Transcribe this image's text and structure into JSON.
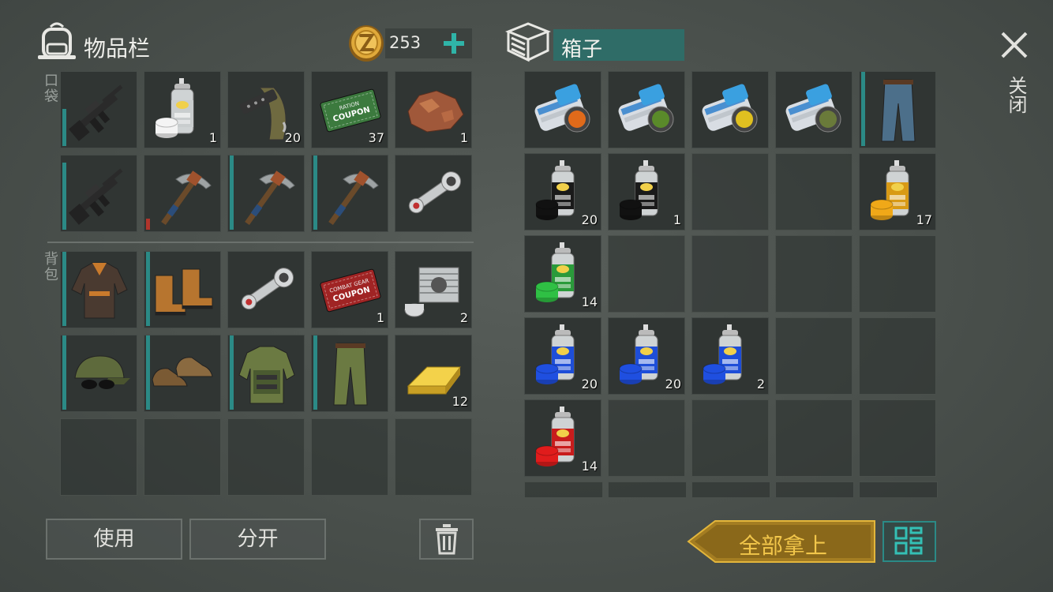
{
  "inventory": {
    "title": "物品栏",
    "pocket_label": "口袋",
    "backpack_label": "背包",
    "coins": "253",
    "plus_icon": "plus-icon",
    "pocket_items": [
      {
        "name": "assault-rifle",
        "qty": "",
        "durability": 0.5
      },
      {
        "name": "aerosol-paint-white",
        "qty": "1"
      },
      {
        "name": "rifle-suppressor-parts",
        "qty": "20"
      },
      {
        "name": "ration-coupon",
        "qty": "37"
      },
      {
        "name": "copper-ore",
        "qty": "1"
      },
      {
        "name": "assault-rifle-2",
        "qty": "",
        "durability": 0.9
      },
      {
        "name": "pickaxe-damaged",
        "qty": "",
        "durability": 0.15,
        "durability_color": "#b0342b"
      },
      {
        "name": "pickaxe",
        "qty": "",
        "durability": 1.0
      },
      {
        "name": "pickaxe-2",
        "qty": "",
        "durability": 1.0
      },
      {
        "name": "piston-rod",
        "qty": ""
      }
    ],
    "backpack_items": [
      {
        "name": "leather-jacket",
        "qty": "",
        "durability": 1.0
      },
      {
        "name": "leather-boots",
        "qty": "",
        "durability": 1.0
      },
      {
        "name": "piston-rod",
        "qty": ""
      },
      {
        "name": "combat-gear-coupon",
        "qty": "1"
      },
      {
        "name": "engine-cylinder",
        "qty": "2"
      },
      {
        "name": "camo-cap-glasses",
        "qty": "",
        "durability": 1.0
      },
      {
        "name": "brown-shoes",
        "qty": "",
        "durability": 1.0
      },
      {
        "name": "tactical-vest",
        "qty": "",
        "durability": 1.0
      },
      {
        "name": "camo-pants",
        "qty": "",
        "durability": 1.0
      },
      {
        "name": "gold-bar",
        "qty": "12"
      }
    ],
    "buttons": {
      "use": "使用",
      "split": "分开"
    }
  },
  "chest": {
    "title": "箱子",
    "rows": [
      [
        {
          "name": "magazine-scroll-orange",
          "qty": ""
        },
        {
          "name": "magazine-scroll-green",
          "qty": ""
        },
        {
          "name": "magazine-scroll-radiation",
          "qty": ""
        },
        {
          "name": "magazine-scroll-camo",
          "qty": ""
        },
        {
          "name": "jeans",
          "qty": "",
          "durability": 1.0
        }
      ],
      [
        {
          "name": "aerosol-paint-black",
          "qty": "20"
        },
        {
          "name": "aerosol-paint-black",
          "qty": "1"
        },
        null,
        null,
        {
          "name": "aerosol-paint-yellow",
          "qty": "17"
        }
      ],
      [
        {
          "name": "aerosol-paint-green",
          "qty": "14"
        },
        null,
        null,
        null,
        null
      ],
      [
        {
          "name": "aerosol-paint-blue",
          "qty": "20"
        },
        {
          "name": "aerosol-paint-blue",
          "qty": "20"
        },
        {
          "name": "aerosol-paint-blue",
          "qty": "2"
        },
        null,
        null
      ],
      [
        {
          "name": "aerosol-paint-red",
          "qty": "14"
        },
        null,
        null,
        null,
        null
      ]
    ],
    "take_all": "全部拿上"
  },
  "close_label": "关闭",
  "colors": {
    "teal": "#2b8a86",
    "gold": "#e3b63b",
    "red_bar": "#b0342b"
  }
}
